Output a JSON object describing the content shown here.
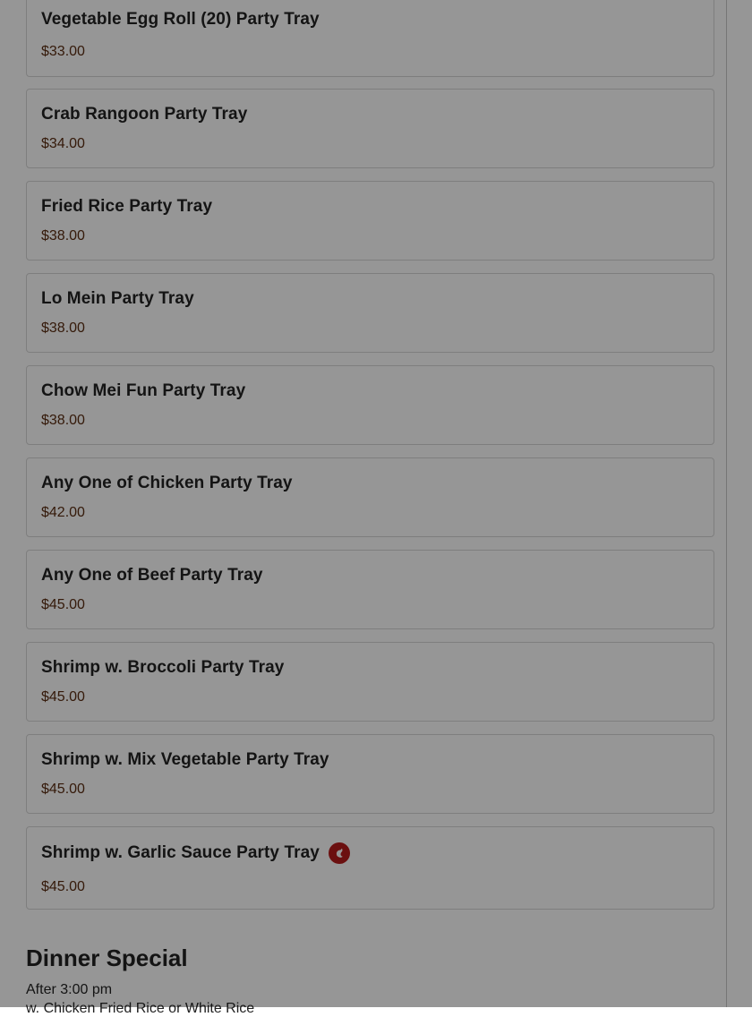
{
  "menu": {
    "items": [
      {
        "name": "Vegetable Egg Roll (20) Party Tray",
        "price": "$33.00"
      },
      {
        "name": "Crab Rangoon Party Tray",
        "price": "$34.00"
      },
      {
        "name": "Fried Rice Party Tray",
        "price": "$38.00"
      },
      {
        "name": "Lo Mein Party Tray",
        "price": "$38.00"
      },
      {
        "name": "Chow Mei Fun Party Tray",
        "price": "$38.00"
      },
      {
        "name": "Any One of Chicken Party Tray",
        "price": "$42.00"
      },
      {
        "name": "Any One of Beef Party Tray",
        "price": "$45.00"
      },
      {
        "name": "Shrimp w. Broccoli Party Tray",
        "price": "$45.00"
      },
      {
        "name": "Shrimp w. Mix Vegetable Party Tray",
        "price": "$45.00"
      },
      {
        "name": "Shrimp w. Garlic Sauce Party Tray",
        "price": "$45.00",
        "icon": "spicy-icon"
      }
    ]
  },
  "section": {
    "title": "Dinner Special",
    "note": "After 3:00 pm",
    "first_line_partial": "w. Chicken Fried Rice or White Rice"
  },
  "theme": {
    "spicy_color": "#b71c1c",
    "price_color": "#5a2d12",
    "overlay_color": "rgba(0,0,0,0.41)"
  }
}
